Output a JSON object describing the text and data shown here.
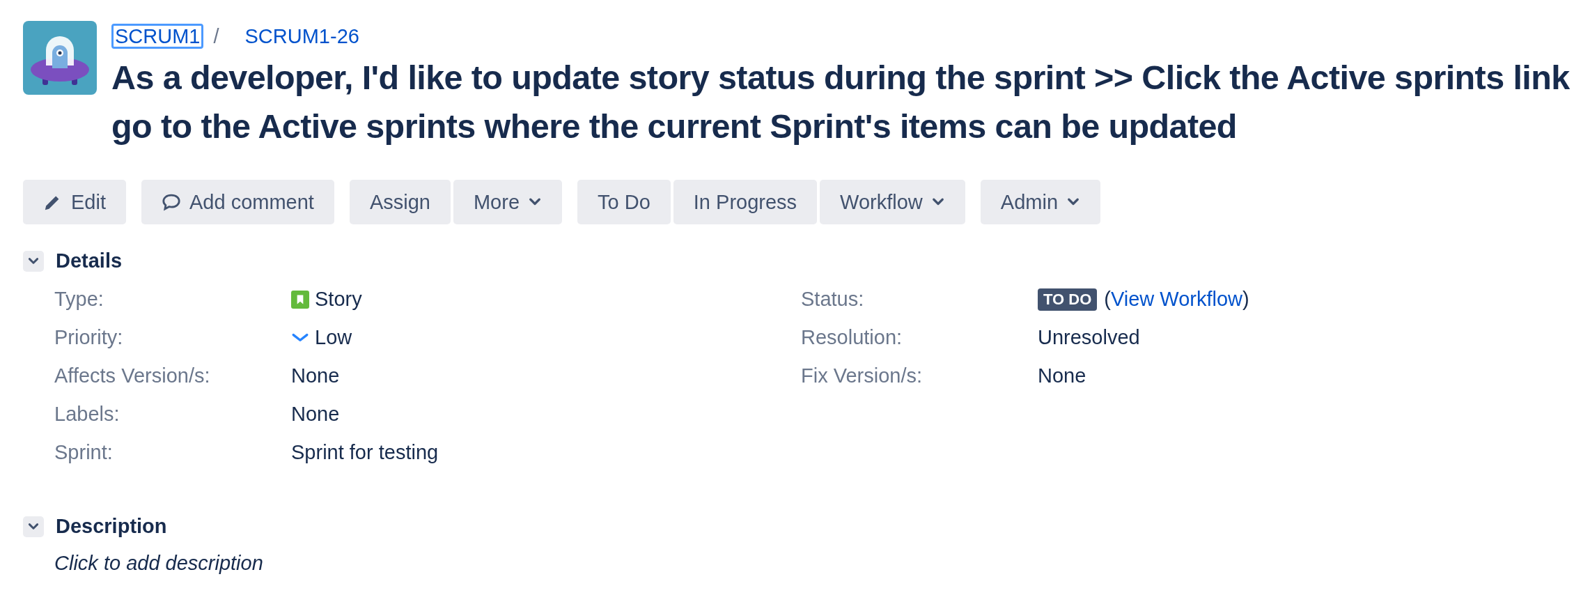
{
  "breadcrumbs": [
    {
      "text": "SCRUM1",
      "focused": true
    },
    {
      "text": "SCRUM1-26",
      "focused": false
    }
  ],
  "breadcrumb_separator": "/",
  "title_lines": [
    "As a developer, I'd like to update story status during the sprint >> Click the Active sprints link",
    "go to the Active sprints where the current Sprint's items can be updated"
  ],
  "toolbar": [
    {
      "buttons": [
        {
          "label": "Edit",
          "kind": "pencil",
          "dropdown": false
        }
      ]
    },
    {
      "buttons": [
        {
          "label": "Add comment",
          "kind": "comment",
          "dropdown": false
        }
      ]
    },
    {
      "buttons": [
        {
          "label": "Assign",
          "dropdown": false
        },
        {
          "label": "More",
          "dropdown": true
        }
      ]
    },
    {
      "buttons": [
        {
          "label": "To Do",
          "dropdown": false
        },
        {
          "label": "In Progress",
          "dropdown": false
        },
        {
          "label": "Workflow",
          "dropdown": true
        }
      ]
    },
    {
      "buttons": [
        {
          "label": "Admin",
          "dropdown": true
        }
      ]
    }
  ],
  "details": {
    "title": "Details",
    "expanded": true,
    "left": [
      {
        "label": "Type:",
        "kind": "issue-type",
        "value": "Story"
      },
      {
        "label": "Priority:",
        "kind": "priority",
        "value": "Low"
      },
      {
        "label": "Affects Version/s:",
        "kind": "text",
        "value": "None"
      },
      {
        "label": "Labels:",
        "kind": "text",
        "value": "None"
      },
      {
        "label": "Sprint:",
        "kind": "text",
        "value": "Sprint for testing"
      }
    ],
    "right": [
      {
        "label": "Status:",
        "kind": "status",
        "value": "TO DO",
        "open": "(",
        "link": "View Workflow",
        "close": ")"
      },
      {
        "label": "Resolution:",
        "kind": "text",
        "value": "Unresolved"
      },
      {
        "label": "Fix Version/s:",
        "kind": "text",
        "value": "None"
      }
    ]
  },
  "description": {
    "title": "Description",
    "expanded": true,
    "placeholder": "Click to add description"
  }
}
